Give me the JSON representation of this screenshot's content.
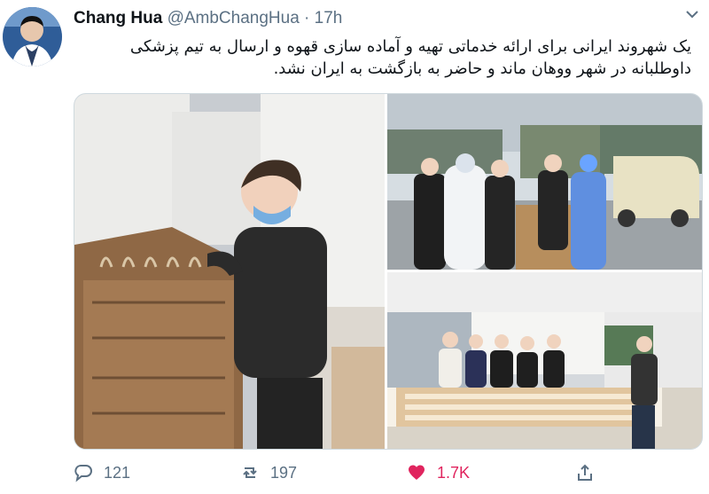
{
  "tweet": {
    "display_name": "Chang Hua",
    "handle": "@AmbChangHua",
    "separator": "·",
    "time": "17h",
    "text_line1": "یک شهروند ایرانی برای ارائه خدماتی تهیه و آماده سازی قهوه و ارسال به تیم پزشکی",
    "text_line2": "داوطلبانه در شهر ووهان ماند و حاضر به بازگشت به ایران نشد."
  },
  "actions": {
    "reply_count": "121",
    "retweet_count": "197",
    "like_count": "1.7K"
  },
  "colors": {
    "like": "#e0245e",
    "muted": "#5b7083",
    "text": "#0f1419"
  },
  "icons": [
    "chevron-down-icon",
    "reply-icon",
    "retweet-icon",
    "heart-icon",
    "share-icon"
  ]
}
